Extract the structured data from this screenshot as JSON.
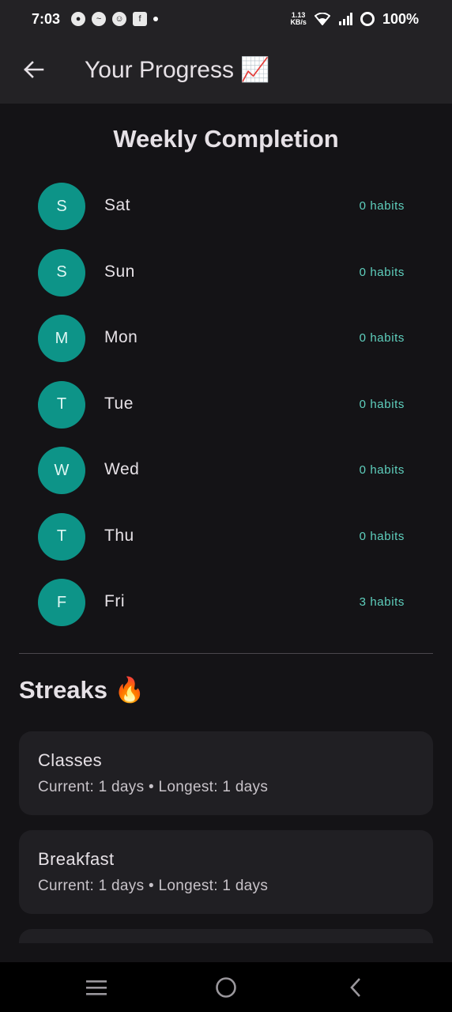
{
  "status_bar": {
    "time": "7:03",
    "net_speed_value": "1.13",
    "net_speed_unit": "KB/s",
    "battery": "100%"
  },
  "app_bar": {
    "title": "Your Progress 📈"
  },
  "weekly": {
    "title": "Weekly Completion",
    "days": [
      {
        "initial": "S",
        "name": "Sat",
        "count": "0 habits"
      },
      {
        "initial": "S",
        "name": "Sun",
        "count": "0 habits"
      },
      {
        "initial": "M",
        "name": "Mon",
        "count": "0 habits"
      },
      {
        "initial": "T",
        "name": "Tue",
        "count": "0 habits"
      },
      {
        "initial": "W",
        "name": "Wed",
        "count": "0 habits"
      },
      {
        "initial": "T",
        "name": "Thu",
        "count": "0 habits"
      },
      {
        "initial": "F",
        "name": "Fri",
        "count": "3 habits"
      }
    ]
  },
  "streaks": {
    "title": "Streaks 🔥",
    "items": [
      {
        "name": "Classes",
        "stats": "Current: 1 days • Longest: 1 days"
      },
      {
        "name": "Breakfast",
        "stats": "Current: 1 days • Longest: 1 days"
      },
      {
        "name": "",
        "stats": ""
      }
    ]
  },
  "colors": {
    "accent": "#0d9488",
    "count_text": "#5fd0be",
    "background": "#141316",
    "card": "#201f23"
  }
}
